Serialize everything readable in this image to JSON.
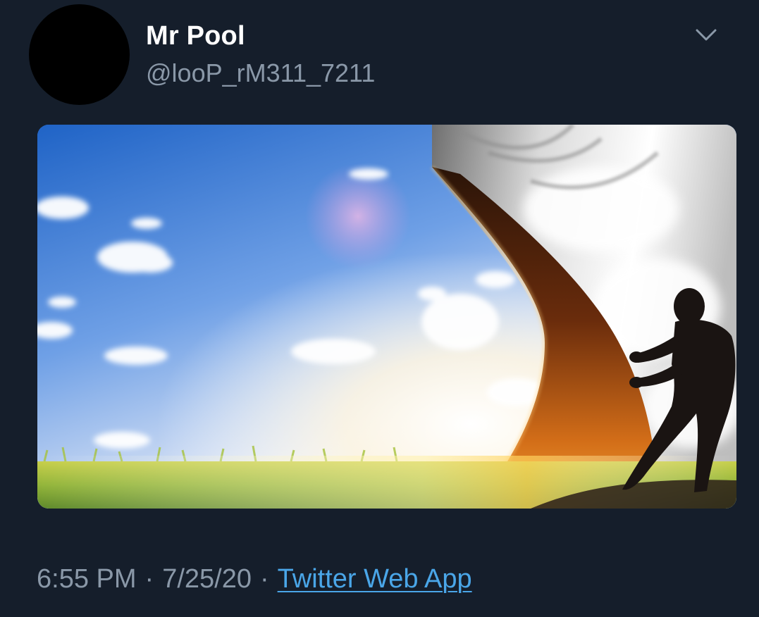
{
  "tweet": {
    "author": {
      "display_name": "Mr Pool",
      "handle": "@looP_rM311_7211",
      "avatar_color": "#000000"
    },
    "menu_icon": "chevron-down-icon",
    "media": {
      "type": "image",
      "subject": "sky-and-grass-scene-with-curtain"
    },
    "time": "6:55 PM",
    "separator": "·",
    "date": "7/25/20",
    "source": "Twitter Web App"
  },
  "colors": {
    "background": "#151e2b",
    "text_primary": "#ffffff",
    "text_secondary": "#8a98a8",
    "link": "#4aa6e8"
  }
}
